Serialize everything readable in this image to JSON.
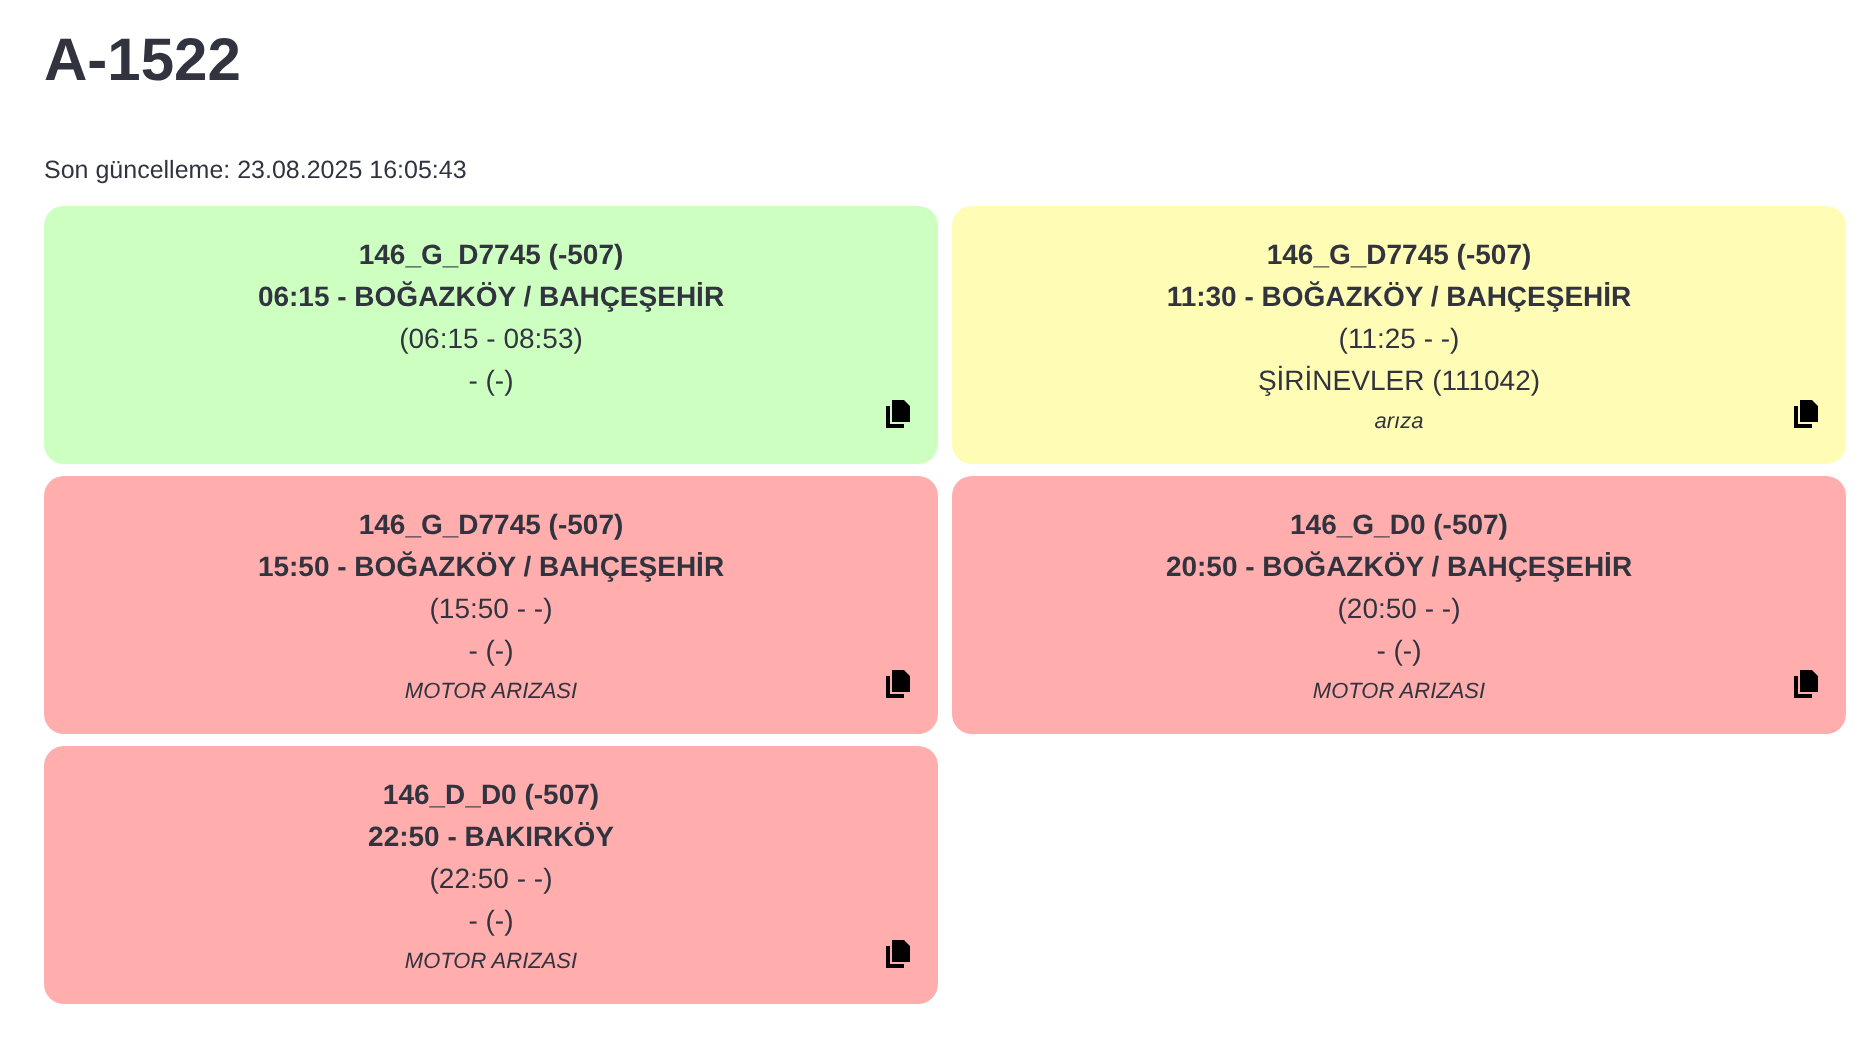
{
  "title": "A-1522",
  "last_update": "Son güncelleme: 23.08.2025 16:05:43",
  "cards": [
    {
      "color": "#ccffc0",
      "code": "146_G_D7745 (-507)",
      "trip": "06:15 - BOĞAZKÖY / BAHÇEŞEHİR",
      "times": "(06:15 - 08:53)",
      "location": "- (-)"
    },
    {
      "color": "#fffdb5",
      "code": "146_G_D7745 (-507)",
      "trip": "11:30 - BOĞAZKÖY / BAHÇEŞEHİR",
      "times": "(11:25 - -)",
      "location": "ŞİRİNEVLER (111042)",
      "note": "arıza"
    },
    {
      "color": "#ffadad",
      "code": "146_G_D7745 (-507)",
      "trip": "15:50 - BOĞAZKÖY / BAHÇEŞEHİR",
      "times": "(15:50 - -)",
      "location": "- (-)",
      "note": "MOTOR ARIZASI"
    },
    {
      "color": "#ffadad",
      "code": "146_G_D0 (-507)",
      "trip": "20:50 - BOĞAZKÖY / BAHÇEŞEHİR",
      "times": "(20:50 - -)",
      "location": "- (-)",
      "note": "MOTOR ARIZASI"
    },
    {
      "color": "#ffadad",
      "code": "146_D_D0 (-507)",
      "trip": "22:50 - BAKIRKÖY",
      "times": "(22:50 - -)",
      "location": "- (-)",
      "note": "MOTOR ARIZASI"
    }
  ]
}
